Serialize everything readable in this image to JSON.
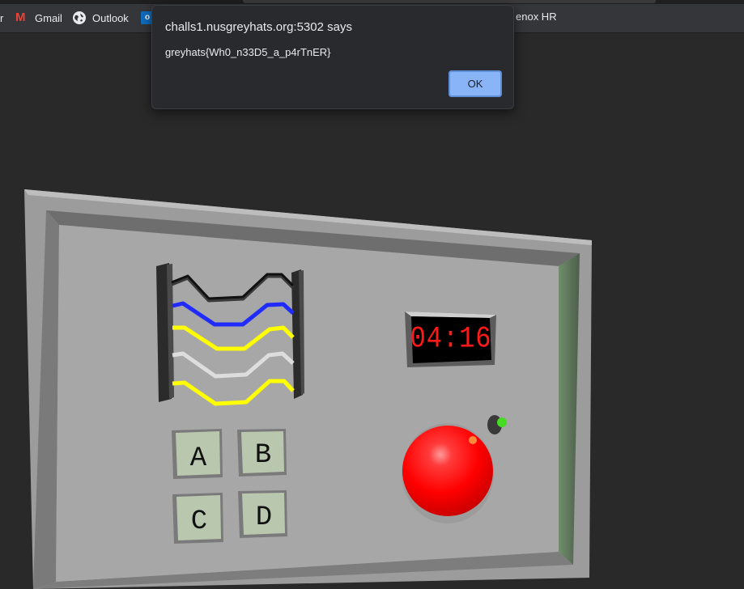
{
  "bookmarks": [
    {
      "icon": "partial-bookmark-icon",
      "label": "r"
    },
    {
      "icon": "gmail-icon",
      "label": "Gmail"
    },
    {
      "icon": "globe-icon",
      "label": "Outlook"
    },
    {
      "icon": "outlook-icon",
      "label": ""
    },
    {
      "icon": "",
      "label": "enox HR"
    }
  ],
  "alert": {
    "origin": "challs1.nusgreyhats.org:5302 says",
    "message": "greyhats{Wh0_n33D5_a_p4rTnER}",
    "ok_label": "OK"
  },
  "bomb": {
    "timer": "04:16",
    "timer_color": "#ff1a1a",
    "buttons": [
      "A",
      "B",
      "C",
      "D"
    ],
    "wires": [
      {
        "color": "#111111"
      },
      {
        "color": "#1f2bff"
      },
      {
        "color": "#ffff00"
      },
      {
        "color": "#dddddd"
      },
      {
        "color": "#ffff00"
      }
    ],
    "big_button_color": "#ff0000",
    "indicator_color": "#44dd22"
  }
}
